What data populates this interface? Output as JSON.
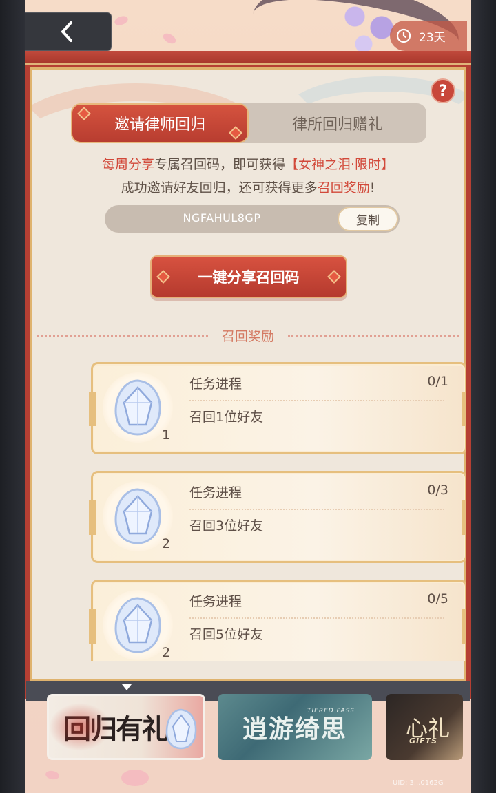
{
  "header": {
    "back_label": "back",
    "timer_text": "23天"
  },
  "tabs": [
    {
      "label": "邀请律师回归",
      "active": true
    },
    {
      "label": "律所回归赠礼",
      "active": false
    }
  ],
  "help_label": "?",
  "intro": {
    "line1_a": "每周分享",
    "line1_b": "专属召回码，即可获得",
    "line1_c": "【女神之泪·限时】",
    "line2_a": "成功邀请好友回归，还可获得更多",
    "line2_b": "召回奖励",
    "line2_c": "!"
  },
  "invite": {
    "code": "NGFAHUL8GP",
    "copy_label": "复制",
    "share_label": "一键分享召回码"
  },
  "rewards": {
    "title": "召回奖励",
    "tasks": [
      {
        "label": "任务进程",
        "progress": "0/1",
        "desc": "召回1位好友",
        "count": "1"
      },
      {
        "label": "任务进程",
        "progress": "0/3",
        "desc": "召回3位好友",
        "count": "2"
      },
      {
        "label": "任务进程",
        "progress": "0/5",
        "desc": "召回5位好友",
        "count": "2"
      }
    ]
  },
  "banners": [
    {
      "title": "回归有礼",
      "selected": true
    },
    {
      "title": "逍游绮思",
      "subtitle": "TIERED PASS",
      "selected": false
    },
    {
      "title": "心礼",
      "subtitle": "GIFTS",
      "selected": false
    }
  ],
  "uid_text": "UID: 3...0162G",
  "colors": {
    "accent_red": "#c8473a",
    "gold": "#dfb36e",
    "panel_bg": "#efe7dc",
    "text_brown": "#5e4f47"
  },
  "icons": [
    "chevron-left-icon",
    "clock-icon",
    "help-icon",
    "gem-icon"
  ]
}
